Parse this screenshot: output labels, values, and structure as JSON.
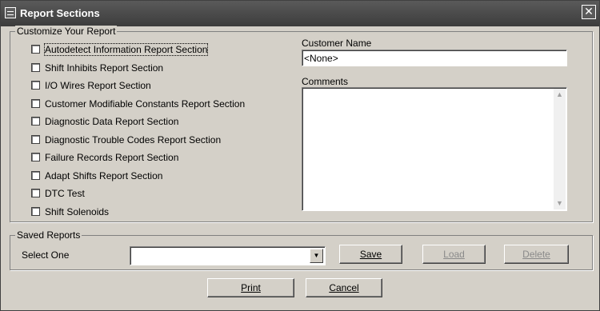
{
  "window": {
    "title": "Report Sections",
    "close_symbol": "✕"
  },
  "customize": {
    "legend": "Customize Your Report",
    "sections": [
      "Autodetect Information Report Section",
      "Shift Inhibits Report Section",
      "I/O Wires Report Section",
      "Customer Modifiable Constants Report Section",
      "Diagnostic Data Report Section",
      "Diagnostic Trouble Codes Report Section",
      "Failure Records Report Section",
      "Adapt Shifts Report Section",
      "DTC Test",
      "Shift Solenoids"
    ],
    "customer_name_label": "Customer Name",
    "customer_name_value": "<None>",
    "comments_label": "Comments",
    "comments_value": ""
  },
  "saved": {
    "legend": "Saved Reports",
    "select_label": "Select One",
    "select_value": "",
    "save_label": "Save",
    "load_label": "Load",
    "delete_label": "Delete"
  },
  "footer": {
    "print_label": "Print",
    "cancel_label": "Cancel"
  },
  "icons": {
    "window_icon": "window-icon",
    "close_icon": "close-icon",
    "dropdown_icon": "chevron-down-icon"
  }
}
